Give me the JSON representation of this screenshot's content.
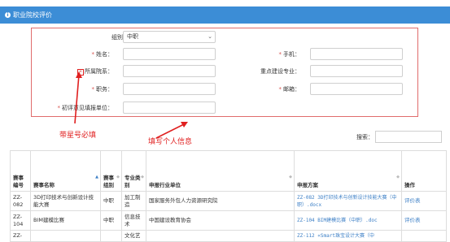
{
  "header": {
    "icon": "info-circle-icon",
    "title": "职业院校评价"
  },
  "form": {
    "group_label": "组别：",
    "group_value": "中职",
    "name_label": "姓名：",
    "phone_label": "手机：",
    "college_label": "所属院系：",
    "construction_label": "重点建设专业：",
    "position_label": "职务：",
    "email_label": "邮箱：",
    "submit_unit_label": "初评意见填报单位："
  },
  "annotations": {
    "required_note": "带星号必填",
    "fill_note": "填写个人信息",
    "color": "#e02020"
  },
  "search": {
    "label": "搜索："
  },
  "table": {
    "headers": [
      "赛事编号",
      "赛事名称",
      "赛事组别",
      "专业类别",
      "申报行业单位",
      "申报方案",
      "操作"
    ],
    "rows": [
      [
        "ZZ-082",
        "3D打印技术与创新设计技能大赛",
        "中职",
        "加工制造",
        "国家服务外包人力资源研究院",
        "ZZ-082 3D打印技术与创新设计技能大赛（中职）.docx",
        "评价表"
      ],
      [
        "ZZ-104",
        "BIM建模比赛",
        "中职",
        "信息技术",
        "中国建设教育协会",
        "ZZ-104 BIM建模比赛（中职）.doc",
        "评价表"
      ],
      [
        "ZZ-",
        "",
        "",
        "文化艺",
        "",
        "ZZ-112 «Smart珠宝设计大赛（中",
        ""
      ]
    ]
  },
  "colors": {
    "header_bg": "#3c8dd6",
    "link": "#3c7fc6",
    "required": "#d9534f",
    "border_highlight": "#e06c6c"
  }
}
